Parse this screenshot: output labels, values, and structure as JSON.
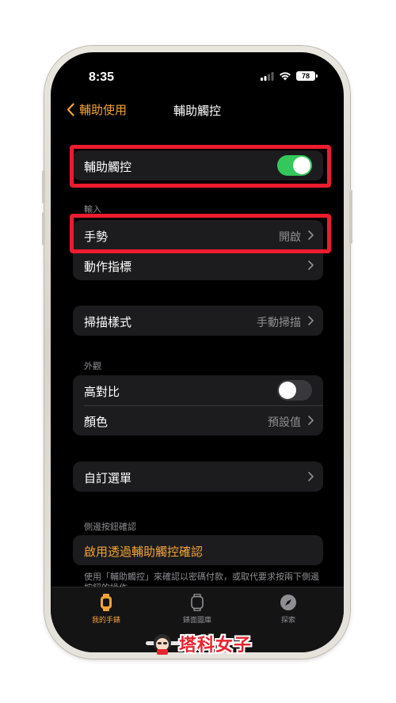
{
  "status_bar": {
    "time": "8:35",
    "battery": "78"
  },
  "nav": {
    "back_label": "輔助使用",
    "title": "輔助觸控"
  },
  "main_toggle": {
    "label": "輔助觸控",
    "on": true
  },
  "input_section": {
    "header": "輸入",
    "items": [
      {
        "label": "手勢",
        "value": "開啟"
      },
      {
        "label": "動作指標",
        "value": ""
      }
    ]
  },
  "scan": {
    "label": "掃描樣式",
    "value": "手動掃描"
  },
  "appearance": {
    "header": "外觀",
    "high_contrast": {
      "label": "高對比",
      "on": false
    },
    "color": {
      "label": "顏色",
      "value": "預設值"
    }
  },
  "custom_menu": {
    "label": "自訂選單"
  },
  "side_button": {
    "header": "側邊按鈕確認",
    "action_label": "啟用透過輔助觸控確認",
    "footnote": "使用「輔助觸控」來確認以密碼付款，或取代要求按兩下側邊按鈕的操作。"
  },
  "tabbar": {
    "tabs": [
      {
        "label": "我的手錶",
        "icon": "watch-icon",
        "active": true
      },
      {
        "label": "錶面圖庫",
        "icon": "watch-face-icon",
        "active": false
      },
      {
        "label": "探索",
        "icon": "compass-icon",
        "active": false
      }
    ]
  },
  "watermark": {
    "text": "塔科女子"
  },
  "colors": {
    "accent": "#f2a33a",
    "toggle_on": "#34c759",
    "highlight": "#ec1c2e",
    "cell_bg": "#1c1c1e"
  }
}
